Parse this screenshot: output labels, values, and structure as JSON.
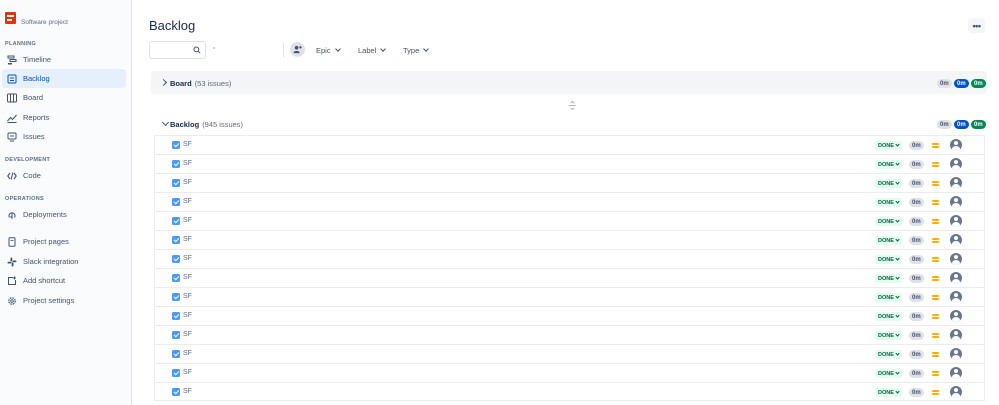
{
  "sidebar": {
    "project_subtitle": "Software project",
    "sections": {
      "planning": "PLANNING",
      "development": "DEVELOPMENT",
      "operations": "OPERATIONS"
    },
    "items": [
      {
        "label": "Timeline",
        "icon": "timeline-icon"
      },
      {
        "label": "Backlog",
        "icon": "backlog-icon",
        "active": true
      },
      {
        "label": "Board",
        "icon": "board-icon"
      },
      {
        "label": "Reports",
        "icon": "reports-icon"
      },
      {
        "label": "Issues",
        "icon": "issues-icon"
      },
      {
        "label": "Code",
        "icon": "code-icon"
      },
      {
        "label": "Deployments",
        "icon": "deployments-icon"
      },
      {
        "label": "Project pages",
        "icon": "pages-icon"
      },
      {
        "label": "Slack integration",
        "icon": "slack-icon"
      },
      {
        "label": "Add shortcut",
        "icon": "add-shortcut-icon"
      },
      {
        "label": "Project settings",
        "icon": "settings-icon"
      }
    ]
  },
  "header": {
    "title": "Backlog",
    "more_label": "•••"
  },
  "toolbar": {
    "search_value": "",
    "filters": [
      {
        "label": "Epic"
      },
      {
        "label": "Label"
      },
      {
        "label": "Type"
      }
    ]
  },
  "board_section": {
    "name": "Board",
    "count": "(53 issues)",
    "pills": [
      "0m",
      "0m",
      "0m"
    ]
  },
  "backlog_section": {
    "name": "Backlog",
    "count": "(945 issues)",
    "pills": [
      "0m",
      "0m",
      "0m"
    ]
  },
  "issues": [
    {
      "key": "SF",
      "status": "DONE",
      "estimate": "0m"
    },
    {
      "key": "SF",
      "status": "DONE",
      "estimate": "0m"
    },
    {
      "key": "SF",
      "status": "DONE",
      "estimate": "0m"
    },
    {
      "key": "SF",
      "status": "DONE",
      "estimate": "0m"
    },
    {
      "key": "SF",
      "status": "DONE",
      "estimate": "0m"
    },
    {
      "key": "SF",
      "status": "DONE",
      "estimate": "0m"
    },
    {
      "key": "SF",
      "status": "DONE",
      "estimate": "0m"
    },
    {
      "key": "SF",
      "status": "DONE",
      "estimate": "0m"
    },
    {
      "key": "SF",
      "status": "DONE",
      "estimate": "0m"
    },
    {
      "key": "SF",
      "status": "DONE",
      "estimate": "0m"
    },
    {
      "key": "SF",
      "status": "DONE",
      "estimate": "0m"
    },
    {
      "key": "SF",
      "status": "DONE",
      "estimate": "0m"
    },
    {
      "key": "SF",
      "status": "DONE",
      "estimate": "0m"
    },
    {
      "key": "SF",
      "status": "DONE",
      "estimate": "0m"
    }
  ],
  "colors": {
    "accent": "#0052cc",
    "done_bg": "#e3fcef",
    "done_text": "#006644",
    "priority_medium": "#ffab00"
  }
}
